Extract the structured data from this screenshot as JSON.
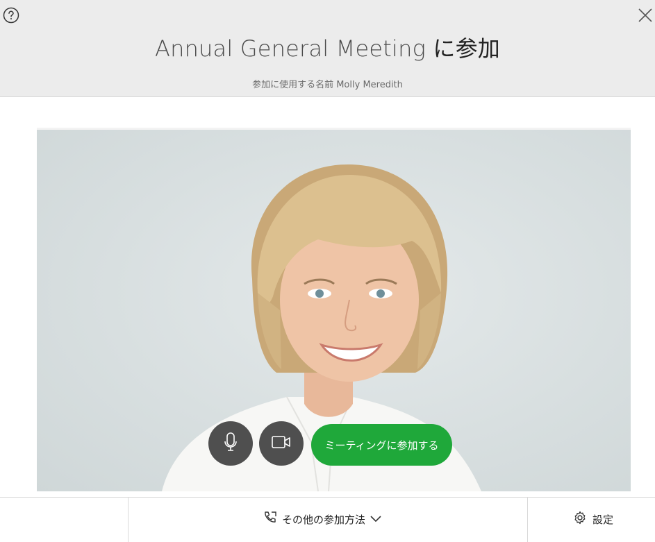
{
  "header": {
    "meeting_name": "Annual General Meeting",
    "title_suffix": " に参加",
    "join_as_label": "参加に使用する名前",
    "user_name": "Molly Meredith"
  },
  "icons": {
    "help": "help-icon",
    "close": "close-icon",
    "microphone": "microphone-icon",
    "camera": "camera-icon",
    "phone": "phone-icon",
    "chevron": "chevron-down-icon",
    "gear": "gear-icon"
  },
  "controls": {
    "join_button_label": "ミーティングに参加する"
  },
  "footer": {
    "other_methods_label": "その他の参加方法",
    "settings_label": "設定"
  },
  "colors": {
    "join_button": "#1fa83a",
    "round_button": "#4f4f4f",
    "header_bg": "#ececec"
  }
}
